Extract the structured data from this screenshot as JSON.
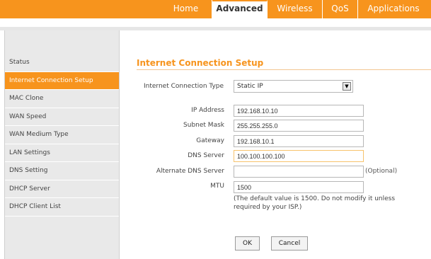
{
  "nav": {
    "tabs": [
      {
        "label": "Home",
        "active": false
      },
      {
        "label": "Advanced",
        "active": true
      },
      {
        "label": "Wireless",
        "active": false
      },
      {
        "label": "QoS",
        "active": false
      },
      {
        "label": "Applications",
        "active": false
      }
    ]
  },
  "sidebar": {
    "items": [
      {
        "label": "Status",
        "active": false
      },
      {
        "label": "Internet Connection Setup",
        "active": true
      },
      {
        "label": "MAC Clone",
        "active": false
      },
      {
        "label": "WAN Speed",
        "active": false
      },
      {
        "label": "WAN Medium Type",
        "active": false
      },
      {
        "label": "LAN Settings",
        "active": false
      },
      {
        "label": "DNS Setting",
        "active": false
      },
      {
        "label": "DHCP Server",
        "active": false
      },
      {
        "label": "DHCP Client List",
        "active": false
      }
    ]
  },
  "main": {
    "title": "Internet Connection Setup",
    "connection_type_label": "Internet Connection Type",
    "connection_type_value": "Static IP",
    "fields": {
      "ip_label": "IP Address",
      "ip_value": "192.168.10.10",
      "subnet_label": "Subnet Mask",
      "subnet_value": "255.255.255.0",
      "gateway_label": "Gateway",
      "gateway_value": "192.168.10.1",
      "dns_label": "DNS Server",
      "dns_value": "100.100.100.100",
      "alt_dns_label": "Alternate DNS Server",
      "alt_dns_value": "",
      "alt_dns_optional": "(Optional)",
      "mtu_label": "MTU",
      "mtu_value": "1500",
      "mtu_hint": "(The default value is 1500. Do not modify it unless required by your ISP.)"
    },
    "buttons": {
      "ok": "OK",
      "cancel": "Cancel"
    }
  },
  "colors": {
    "accent": "#f7941d",
    "sidebar_bg": "#e9e9e9"
  }
}
